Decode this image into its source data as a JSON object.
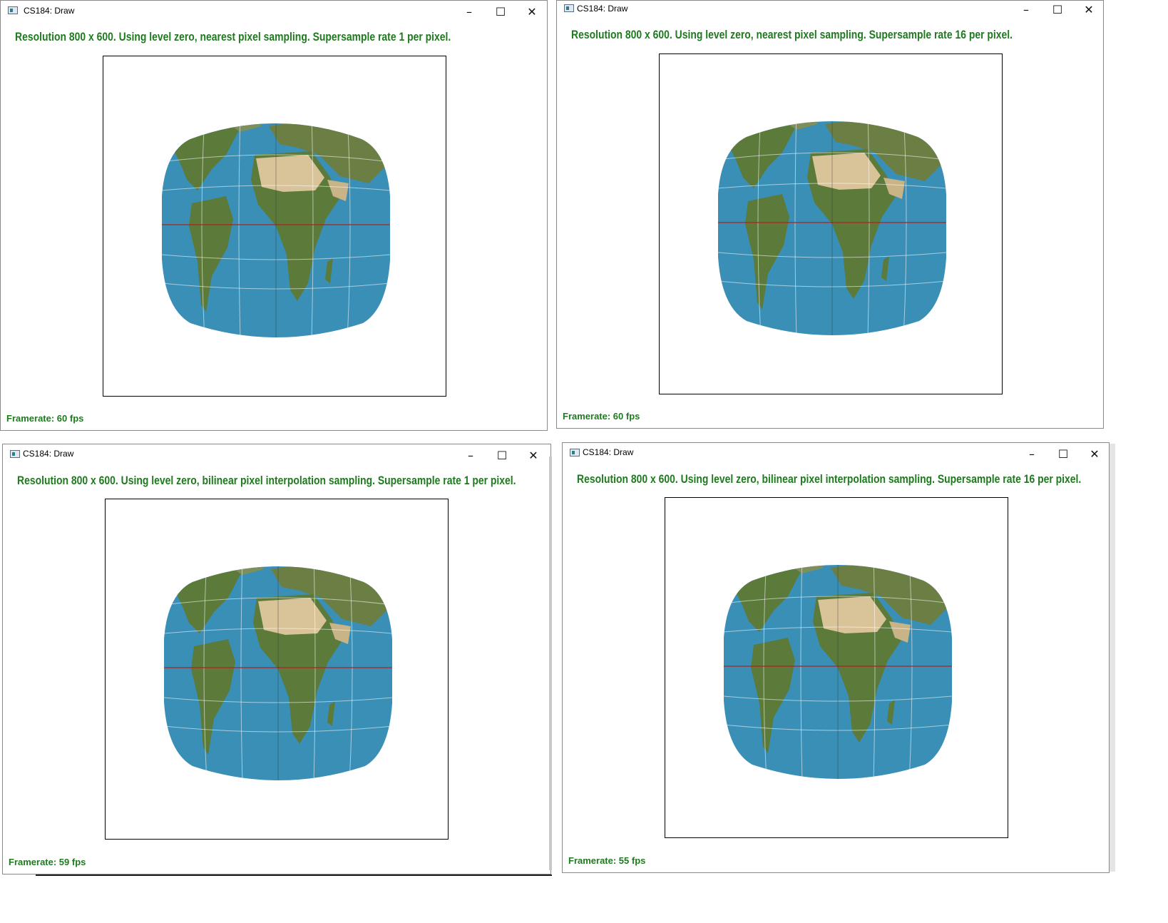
{
  "windows": [
    {
      "title": "CS184: Draw",
      "status": "Resolution 800 x 600. Using level zero, nearest pixel sampling. Supersample rate 1 per pixel.",
      "framerate": "Framerate: 60 fps"
    },
    {
      "title": "CS184: Draw",
      "status": "Resolution 800 x 600. Using level zero, nearest pixel sampling. Supersample rate 16 per pixel.",
      "framerate": "Framerate: 60 fps"
    },
    {
      "title": "CS184: Draw",
      "status": "Resolution 800 x 600. Using level zero, bilinear pixel interpolation sampling. Supersample rate 1 per pixel.",
      "framerate": "Framerate: 59 fps"
    },
    {
      "title": "CS184: Draw",
      "status": "Resolution 800 x 600. Using level zero, bilinear pixel interpolation sampling. Supersample rate 16 per pixel.",
      "framerate": "Framerate: 55 fps"
    }
  ],
  "window_controls": {
    "minimize": "–",
    "maximize": "☐",
    "close": "✕"
  },
  "colors": {
    "status_text": "#1f7a1f",
    "ocean": "#3a8fb7",
    "land": "#5c7a3a",
    "desert": "#d9c49a",
    "equator": "#b02020"
  }
}
